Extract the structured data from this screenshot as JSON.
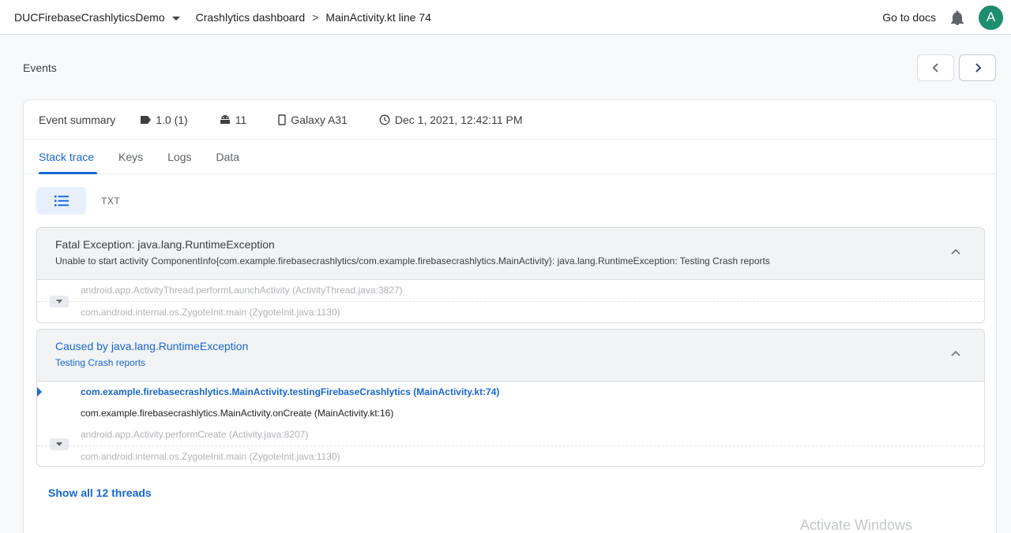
{
  "topbar": {
    "project": "DUCFirebaseCrashlyticsDemo",
    "breadcrumb": [
      "Crashlytics dashboard",
      "MainActivity.kt line 74"
    ],
    "docs": "Go to docs",
    "avatar_letter": "A"
  },
  "events": {
    "title": "Events"
  },
  "summary": {
    "label": "Event summary",
    "version": "1.0 (1)",
    "android": "11",
    "device": "Galaxy A31",
    "datetime": "Dec 1, 2021, 12:42:11 PM"
  },
  "tabs": [
    "Stack trace",
    "Keys",
    "Logs",
    "Data"
  ],
  "view": {
    "txt": "TXT"
  },
  "fatal": {
    "title": "Fatal Exception: java.lang.RuntimeException",
    "message": "Unable to start activity ComponentInfo{com.example.firebasecrashlytics/com.example.firebasecrashlytics.MainActivity}: java.lang.RuntimeException: Testing Crash reports",
    "frames": [
      "android.app.ActivityThread.performLaunchActivity (ActivityThread.java:3827)",
      "com.android.internal.os.ZygoteInit.main (ZygoteInit.java:1130)"
    ]
  },
  "caused": {
    "title": "Caused by java.lang.RuntimeException",
    "message": "Testing Crash reports",
    "frames": [
      "com.example.firebasecrashlytics.MainActivity.testingFirebaseCrashlytics (MainActivity.kt:74)",
      "com.example.firebasecrashlytics.MainActivity.onCreate (MainActivity.kt:16)",
      "android.app.Activity.performCreate (Activity.java:8207)",
      "com.android.internal.os.ZygoteInit.main (ZygoteInit.java:1130)"
    ]
  },
  "show_threads": "Show all 12 threads",
  "watermark": "Activate Windows",
  "colors": {
    "accent": "#1967d2",
    "avatar": "#1e8e6e"
  }
}
